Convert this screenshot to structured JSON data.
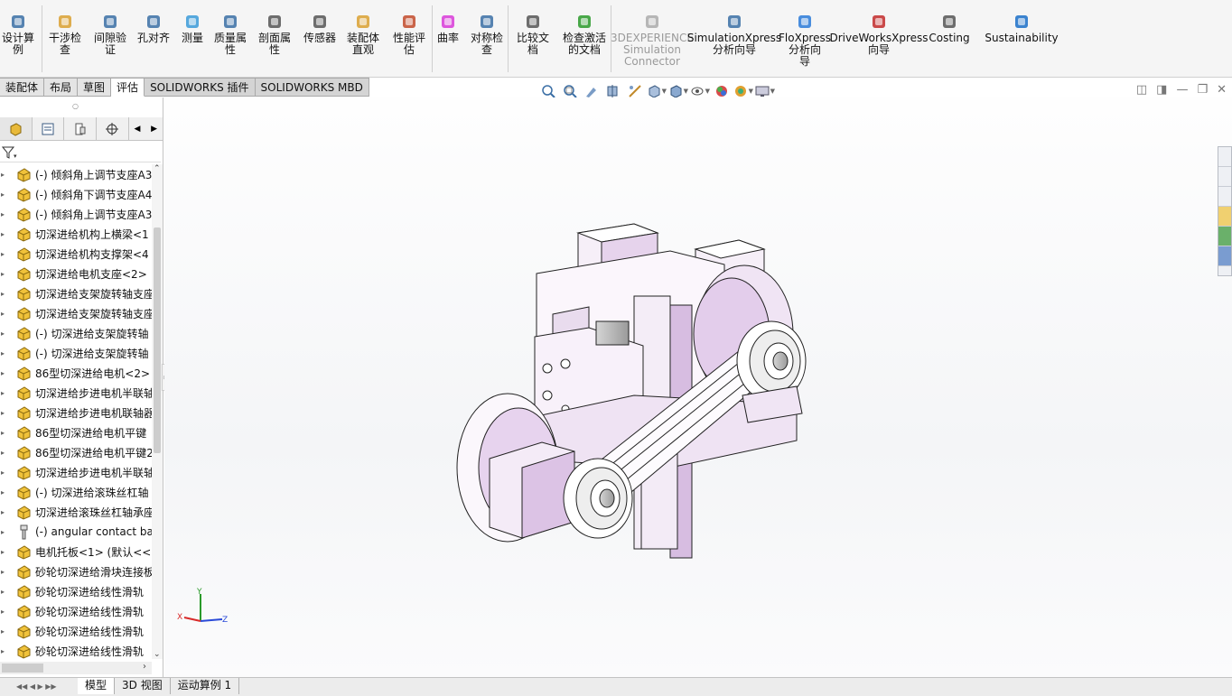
{
  "ribbon": {
    "buttons": [
      {
        "label": "设计算\n例",
        "icon": "design-study-icon"
      },
      {
        "label": "干涉检\n查",
        "icon": "interference-icon"
      },
      {
        "label": "间隙验\n证",
        "icon": "clearance-icon"
      },
      {
        "label": "孔对齐",
        "icon": "hole-align-icon"
      },
      {
        "label": "测量",
        "icon": "measure-icon"
      },
      {
        "label": "质量属\n性",
        "icon": "mass-props-icon"
      },
      {
        "label": "剖面属\n性",
        "icon": "section-props-icon"
      },
      {
        "label": "传感器",
        "icon": "sensor-icon"
      },
      {
        "label": "装配体\n直观",
        "icon": "assembly-visual-icon"
      },
      {
        "label": "性能评\n估",
        "icon": "performance-icon"
      },
      {
        "label": "曲率",
        "icon": "curvature-icon"
      },
      {
        "label": "对称检\n查",
        "icon": "symmetry-icon"
      },
      {
        "label": "比较文\n档",
        "icon": "compare-docs-icon"
      },
      {
        "label": "检查激活\n的文档",
        "icon": "check-doc-icon"
      },
      {
        "label": "3DEXPERIENCE\nSimulation\nConnector",
        "icon": "3dx-icon"
      },
      {
        "label": "SimulationXpress\n分析向导",
        "icon": "simxpress-icon"
      },
      {
        "label": "FloXpress\n分析向\n导",
        "icon": "floxpress-icon"
      },
      {
        "label": "DriveWorksXpress\n向导",
        "icon": "driveworks-icon"
      },
      {
        "label": "Costing",
        "icon": "costing-icon"
      },
      {
        "label": "Sustainability",
        "icon": "sustainability-icon"
      }
    ]
  },
  "tabs": [
    "装配体",
    "布局",
    "草图",
    "评估",
    "SOLIDWORKS 插件",
    "SOLIDWORKS MBD"
  ],
  "tree": {
    "items": [
      {
        "label": "(-) 倾斜角上调节支座A3",
        "icon": "part-icon"
      },
      {
        "label": "(-) 倾斜角下调节支座A4",
        "icon": "part-icon"
      },
      {
        "label": "(-) 倾斜角上调节支座A3",
        "icon": "part-icon"
      },
      {
        "label": "切深进给机构上横梁<1",
        "icon": "part-icon"
      },
      {
        "label": "切深进给机构支撑架<4",
        "icon": "part-icon"
      },
      {
        "label": "切深进给电机支座<2>",
        "icon": "part-icon"
      },
      {
        "label": "切深进给支架旋转轴支座",
        "icon": "part-icon"
      },
      {
        "label": "切深进给支架旋转轴支座",
        "icon": "part-icon"
      },
      {
        "label": "(-) 切深进给支架旋转轴",
        "icon": "part-icon"
      },
      {
        "label": "(-) 切深进给支架旋转轴",
        "icon": "part-icon"
      },
      {
        "label": "86型切深进给电机<2>",
        "icon": "part-icon"
      },
      {
        "label": "切深进给步进电机半联轴",
        "icon": "part-icon"
      },
      {
        "label": "切深进给步进电机联轴器",
        "icon": "part-icon"
      },
      {
        "label": "86型切深进给电机平键",
        "icon": "part-icon"
      },
      {
        "label": "86型切深进给电机平键2",
        "icon": "part-icon"
      },
      {
        "label": "切深进给步进电机半联轴",
        "icon": "part-icon"
      },
      {
        "label": "(-) 切深进给滚珠丝杠轴",
        "icon": "part-icon"
      },
      {
        "label": "切深进给滚珠丝杠轴承座",
        "icon": "part-icon"
      },
      {
        "label": "(-) angular contact ba",
        "icon": "bolt-icon"
      },
      {
        "label": "电机托板<1> (默认<<",
        "icon": "part-icon"
      },
      {
        "label": "砂轮切深进给滑块连接板",
        "icon": "part-icon"
      },
      {
        "label": "砂轮切深进给线性滑轨",
        "icon": "part-icon"
      },
      {
        "label": "砂轮切深进给线性滑轨",
        "icon": "part-icon"
      },
      {
        "label": "砂轮切深进给线性滑轨",
        "icon": "part-icon"
      },
      {
        "label": "砂轮切深进给线性滑轨",
        "icon": "part-icon"
      }
    ]
  },
  "triad": {
    "x": "X",
    "y": "Y",
    "z": "Z"
  },
  "bottom_tabs": [
    "模型",
    "3D 视图",
    "运动算例 1"
  ],
  "colors": {
    "part_fill": "#e9d6ef",
    "accent": "#0a64c8"
  }
}
